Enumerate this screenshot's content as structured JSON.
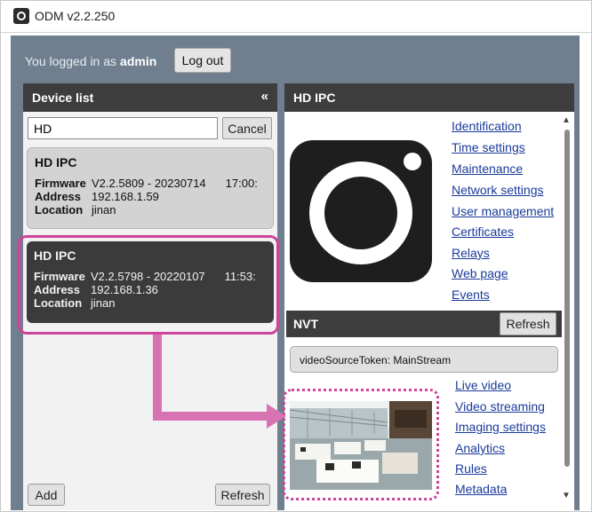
{
  "app": {
    "title": "ODM v2.2.250"
  },
  "login": {
    "prefix": "You logged in as",
    "user": "admin",
    "logout_label": "Log out"
  },
  "device_list": {
    "title": "Device list",
    "collapse_glyph": "«",
    "search": {
      "value": "HD"
    },
    "cancel_label": "Cancel",
    "devices": [
      {
        "name": "HD IPC",
        "firmware_label": "Firmware",
        "firmware": "V2.2.5809 - 20230714",
        "time": "17:00:",
        "address_label": "Address",
        "address": "192.168.1.59",
        "location_label": "Location",
        "location": "jinan"
      },
      {
        "name": "HD IPC",
        "firmware_label": "Firmware",
        "firmware": "V2.2.5798 - 20220107",
        "time": "11:53:",
        "address_label": "Address",
        "address": "192.168.1.36",
        "location_label": "Location",
        "location": "jinan"
      }
    ],
    "add_label": "Add",
    "refresh_label": "Refresh"
  },
  "detail": {
    "title": "HD IPC",
    "links": [
      "Identification",
      "Time settings",
      "Maintenance",
      "Network settings",
      "User management",
      "Certificates",
      "Relays",
      "Web page",
      "Events"
    ],
    "nvt": {
      "title": "NVT",
      "refresh_label": "Refresh",
      "video_source": "videoSourceToken: MainStream",
      "links": [
        "Live video",
        "Video streaming",
        "Imaging settings",
        "Analytics",
        "Rules",
        "Metadata"
      ]
    }
  },
  "colors": {
    "accent_highlight": "#d0439a",
    "arrow": "#d873b3",
    "header_dark": "#3d3d3d",
    "link": "#1a3a9a"
  },
  "icons": [
    "app-camera-icon",
    "collapse-icon",
    "camera-icon",
    "scroll-up-icon",
    "scroll-down-icon"
  ]
}
